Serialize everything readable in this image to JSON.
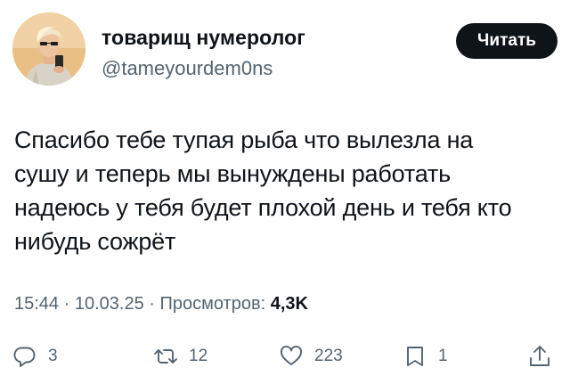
{
  "author": {
    "display_name": "товарищ нумеролог",
    "handle": "@tameyourdem0ns"
  },
  "follow_button_label": "Читать",
  "tweet": {
    "lines": [
      "Спасибо тебе тупая рыба что вылезла на",
      "сушу и теперь мы вынуждены работать",
      "надеюсь у тебя будет плохой день и тебя кто",
      "нибудь сожрёт"
    ]
  },
  "meta": {
    "time": "15:44",
    "date": "10.03.25",
    "views_label": "Просмотров:",
    "views_count": "4,3K",
    "separator": " · "
  },
  "actions": {
    "replies": "3",
    "reposts": "12",
    "likes": "223",
    "bookmarks": "1"
  },
  "icons": {
    "reply": "reply-icon",
    "repost": "repost-icon",
    "like": "heart-icon",
    "bookmark": "bookmark-icon",
    "share": "share-icon"
  },
  "colors": {
    "text": "#0f1419",
    "secondary": "#536471",
    "button_bg": "#0f1419"
  }
}
